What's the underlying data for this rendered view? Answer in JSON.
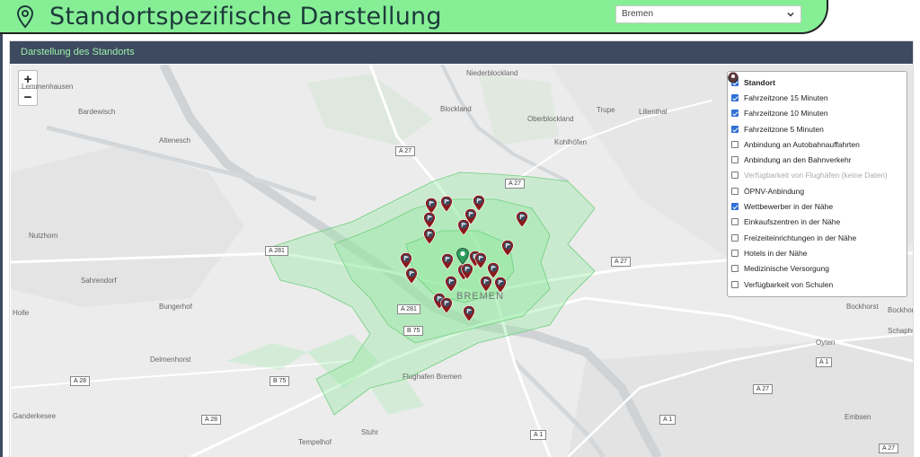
{
  "header": {
    "title": "Standortspezifische Darstellung",
    "city_select": {
      "value": "Bremen"
    }
  },
  "card": {
    "title": "Darstellung des Standorts"
  },
  "zoom": {
    "in": "+",
    "out": "−"
  },
  "legend": [
    {
      "label": "Standort",
      "checked": true,
      "bold": true,
      "disabled": false,
      "icon": "standort-pin-icon",
      "color": "#2e9e5a"
    },
    {
      "label": "Fahrzeitzone 15 Minuten",
      "checked": true,
      "bold": false,
      "disabled": false,
      "icon": "clock-icon",
      "color": "#222222"
    },
    {
      "label": "Fahrzeitzone 10 Minuten",
      "checked": true,
      "bold": false,
      "disabled": false,
      "icon": "clock-icon",
      "color": "#222222"
    },
    {
      "label": "Fahrzeitzone 5 Minuten",
      "checked": true,
      "bold": false,
      "disabled": false,
      "icon": "clock-icon",
      "color": "#222222"
    },
    {
      "label": "Anbindung an Autobahnauffahrten",
      "checked": false,
      "bold": false,
      "disabled": false,
      "icon": "highway-pin-icon",
      "color": "#3d4a60"
    },
    {
      "label": "Anbindung an den Bahnverkehr",
      "checked": false,
      "bold": false,
      "disabled": false,
      "icon": "train-pin-icon",
      "color": "#3d4a60"
    },
    {
      "label": "Verfügbarkeit von Flughäfen (keine Daten)",
      "checked": false,
      "bold": false,
      "disabled": true,
      "icon": "airport-pin-icon",
      "color": "#3d4a60"
    },
    {
      "label": "ÖPNV-Anbindung",
      "checked": false,
      "bold": false,
      "disabled": false,
      "icon": "transit-pin-icon",
      "color": "#9ab52a"
    },
    {
      "label": "Wettbewerber in der Nähe",
      "checked": true,
      "bold": false,
      "disabled": false,
      "icon": "competitor-pin-icon",
      "color": "#8a1a1a"
    },
    {
      "label": "Einkaufszentren in der Nähe",
      "checked": false,
      "bold": false,
      "disabled": false,
      "icon": "shopping-pin-icon",
      "color": "#a08a6e"
    },
    {
      "label": "Freizeiteinrichtungen in der Nähe",
      "checked": false,
      "bold": false,
      "disabled": false,
      "icon": "leisure-pin-icon",
      "color": "#3d4a60"
    },
    {
      "label": "Hotels in der Nähe",
      "checked": false,
      "bold": false,
      "disabled": false,
      "icon": "hotel-pin-icon",
      "color": "#3d4a60"
    },
    {
      "label": "Medizinische Versorgung",
      "checked": false,
      "bold": false,
      "disabled": false,
      "icon": "medical-pin-icon",
      "color": "#c0392b"
    },
    {
      "label": "Verfügbarkeit von Schulen",
      "checked": false,
      "bold": false,
      "disabled": false,
      "icon": "school-pin-icon",
      "color": "#5a3a3a"
    }
  ],
  "map": {
    "road_labels": [
      "A 27",
      "A 27",
      "A 281",
      "A 281",
      "A 27",
      "A 1",
      "A 27",
      "A 28",
      "B 75",
      "B 75",
      "A 28",
      "A 1",
      "A 1",
      "A 27"
    ],
    "place_labels": [
      "Niederblockland",
      "Blockland",
      "Oberblockland",
      "Trupe",
      "Lilienthal",
      "Kohlhöfen",
      "Bardewisch",
      "Altenesch",
      "Nutzhorn",
      "Sahrendorf",
      "Bungerhof",
      "Delmenhorst",
      "Flughafen Bremen",
      "Stuhr",
      "Tempelhof",
      "Bockhorst",
      "Bockhorn",
      "Schaphusen",
      "Oyten",
      "Embsen",
      "Ganderkesee",
      "Holle",
      "Lemmenhausen",
      "BREMEN"
    ]
  },
  "colors": {
    "header": "#86ef96",
    "card_header": "#3d4a60",
    "zone": "#8de89a",
    "competitor_pin": "#8a1a1a",
    "standort_pin": "#2e9e5a"
  }
}
